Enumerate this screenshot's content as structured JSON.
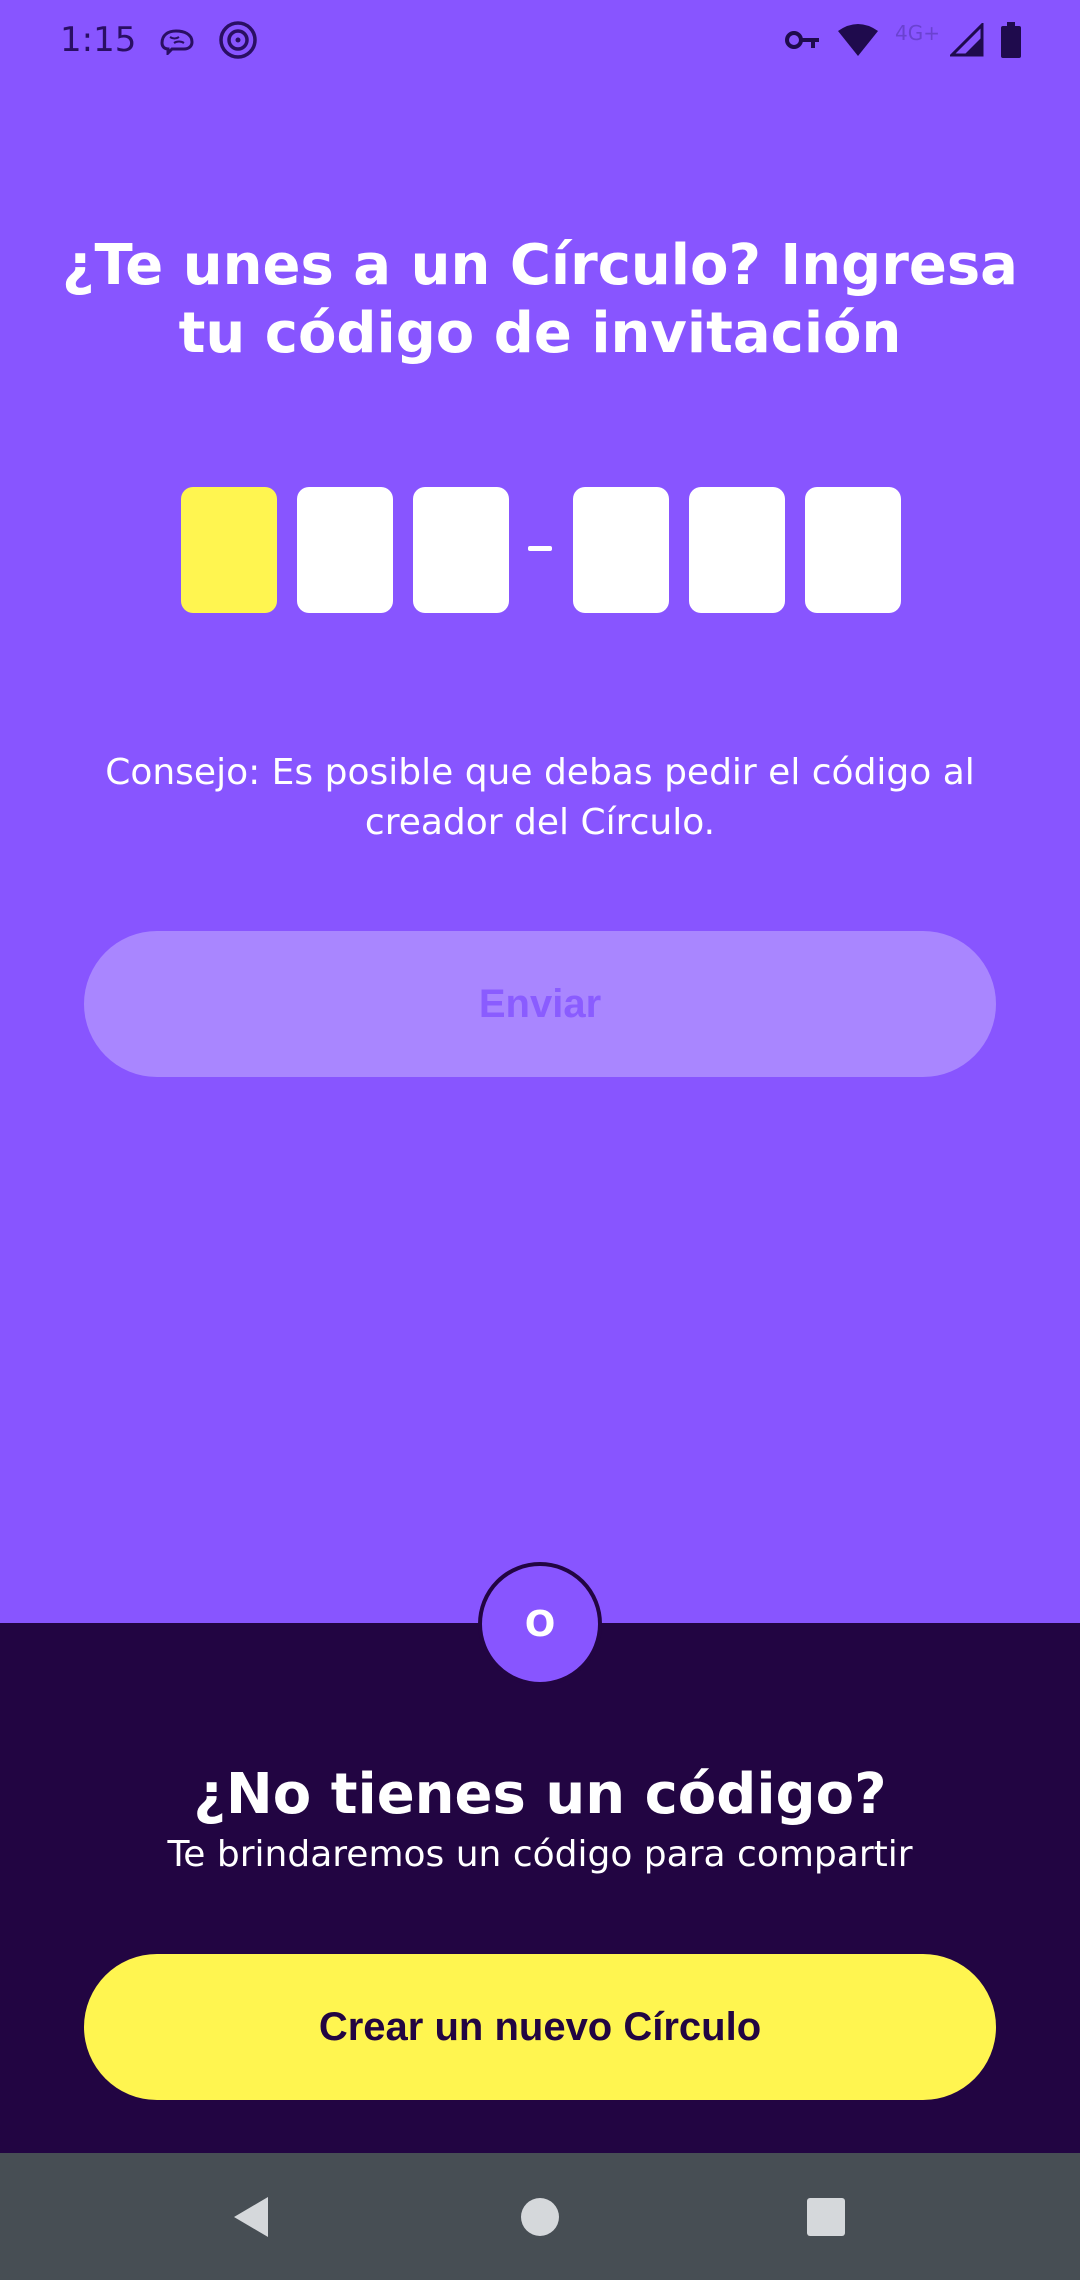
{
  "status_bar": {
    "time": "1:15",
    "network_label": "4G+",
    "icons": [
      "brain-icon",
      "target-icon",
      "vpn-key-icon",
      "wifi-icon",
      "signal-icon",
      "battery-icon"
    ]
  },
  "join": {
    "title": "¿Te unes a un Círculo? Ingresa tu código de invitación",
    "code_slots": [
      "",
      "",
      "",
      "",
      "",
      ""
    ],
    "active_slot": 0,
    "tip": "Consejo: Es posible que debas pedir el código al creador del Círculo.",
    "submit_label": "Enviar"
  },
  "divider": {
    "label": "O"
  },
  "create": {
    "title": "¿No tienes un código?",
    "subtitle": "Te brindaremos un código para compartir",
    "button_label": "Crear un nuevo Círculo"
  },
  "nav": {
    "icons": [
      "back-icon",
      "home-icon",
      "recents-icon"
    ]
  },
  "colors": {
    "background": "#8855ff",
    "panel": "#220542",
    "accent": "#fff550",
    "disabled_button": "#a986ff",
    "nav_bar": "#474e54"
  }
}
